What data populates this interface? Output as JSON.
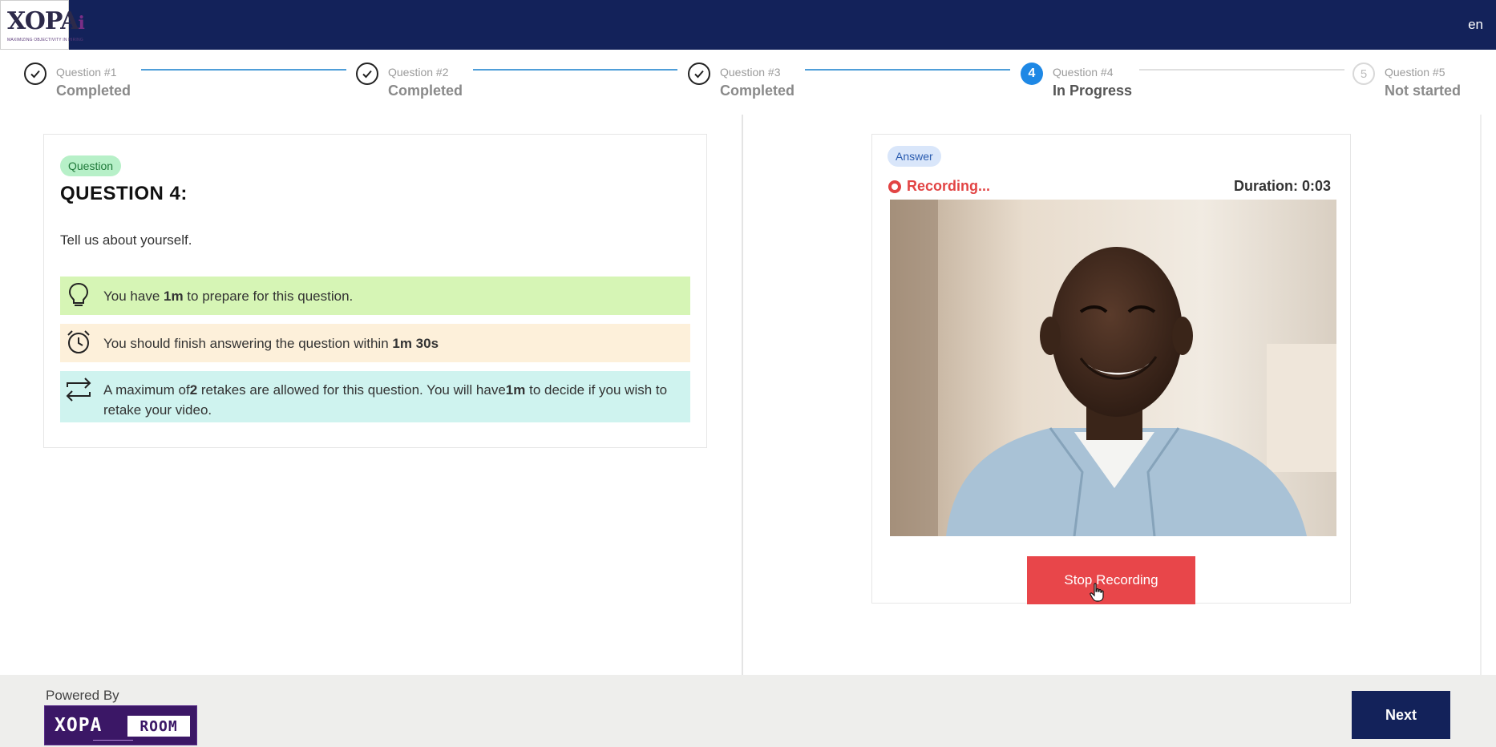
{
  "header": {
    "logo_text": "XOPA",
    "logo_suffix": "i",
    "logo_tagline": "MAXIMIZING OBJECTIVITY IN HIRING",
    "language": "en"
  },
  "stepper": {
    "steps": [
      {
        "label": "Question #1",
        "status": "Completed",
        "state": "done"
      },
      {
        "label": "Question #2",
        "status": "Completed",
        "state": "done"
      },
      {
        "label": "Question #3",
        "status": "Completed",
        "state": "done"
      },
      {
        "label": "Question #4",
        "status": "In Progress",
        "state": "active",
        "number": "4"
      },
      {
        "label": "Question #5",
        "status": "Not started",
        "state": "pending",
        "number": "5"
      }
    ]
  },
  "question": {
    "badge": "Question",
    "title": "QUESTION 4:",
    "text": "Tell us about yourself.",
    "prep_prefix": "You have ",
    "prep_value": "1m",
    "prep_suffix": " to prepare for this question.",
    "finish_prefix": "You should finish answering the question within ",
    "finish_value": "1m 30s",
    "retake_prefix": "A maximum of",
    "retake_count": "2",
    "retake_middle": " retakes are allowed for this question. You will have",
    "retake_time": "1m",
    "retake_suffix": " to decide if you wish to retake your video."
  },
  "answer": {
    "badge": "Answer",
    "recording_label": "Recording...",
    "duration": "Duration: 0:03",
    "stop_label": "Stop Recording"
  },
  "footer": {
    "powered_by": "Powered By",
    "room_logo_left": "XOPA",
    "room_logo_right": "ROOM",
    "next_label": "Next"
  },
  "colors": {
    "navy": "#13225a",
    "record_red": "#e8464a",
    "step_active": "#1e88e5",
    "step_line": "#4f9ed9"
  }
}
